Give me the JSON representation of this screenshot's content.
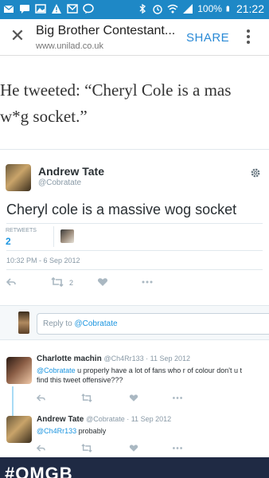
{
  "status_bar": {
    "battery": "100%",
    "time": "21:22",
    "icons": [
      "mail-icon",
      "message-icon",
      "gallery-icon",
      "warning-icon",
      "gmail-icon",
      "chat-icon",
      "bluetooth-icon",
      "alarm-icon",
      "wifi-icon",
      "signal-icon",
      "battery-icon"
    ]
  },
  "toolbar": {
    "close_icon": "close-icon",
    "title": "Big Brother Contestant...",
    "url": "www.unilad.co.uk",
    "share_label": "SHARE",
    "menu_icon": "overflow-menu-icon"
  },
  "article": {
    "line1": "He tweeted: “Cheryl Cole is a mas",
    "line2": "w*g socket.”"
  },
  "tweet": {
    "name": "Andrew Tate",
    "handle": "@Cobratate",
    "text": "Cheryl cole is a massive wog socket",
    "retweets_label": "RETWEETS",
    "retweets_count": "2",
    "timestamp": "10:32 PM - 6 Sep 2012",
    "retweet_action_count": "2"
  },
  "reply_box": {
    "prefix": "Reply to ",
    "mention": "@Cobratate"
  },
  "replies": [
    {
      "name": "Charlotte machin",
      "handle_date": "@Ch4Rr133 · 11 Sep 2012",
      "mention": "@Cobratate",
      "text": " u properly have a lot of fans who r of colour don't u t",
      "text2": "find this tweet offensive???"
    },
    {
      "name": "Andrew Tate",
      "handle_date": "@Cobratate · 11 Sep 2012",
      "mention": "@Ch4Rr133",
      "text": " probably"
    }
  ],
  "banner": {
    "text": "#OMGB"
  },
  "colors": {
    "status_bar": "#1e88c6",
    "link_blue": "#1b95e0",
    "share_blue": "#2a8ad6",
    "banner": "#1f2a44"
  }
}
